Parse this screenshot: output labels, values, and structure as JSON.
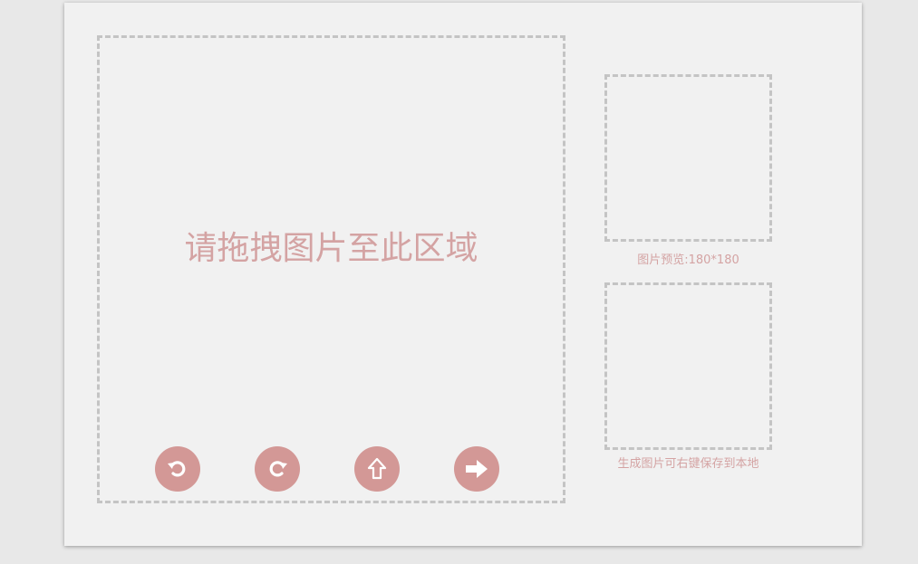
{
  "drop_zone": {
    "prompt": "请拖拽图片至此区域"
  },
  "toolbar": {
    "buttons": [
      {
        "icon": "rotate-left-icon",
        "glyph": "↶"
      },
      {
        "icon": "rotate-right-icon",
        "glyph": "↷"
      },
      {
        "icon": "upload-icon",
        "glyph": "⇧"
      },
      {
        "icon": "arrow-right-icon",
        "glyph": "➡"
      }
    ]
  },
  "preview": {
    "caption": "图片预览:180*180"
  },
  "output": {
    "caption": "生成图片可右键保存到本地"
  },
  "colors": {
    "accent": "#d39896",
    "text_accent": "#d4a3a3",
    "dashed_border": "#c4c4c4",
    "panel_bg": "#f1f1f1",
    "page_bg": "#e8e8e8"
  }
}
